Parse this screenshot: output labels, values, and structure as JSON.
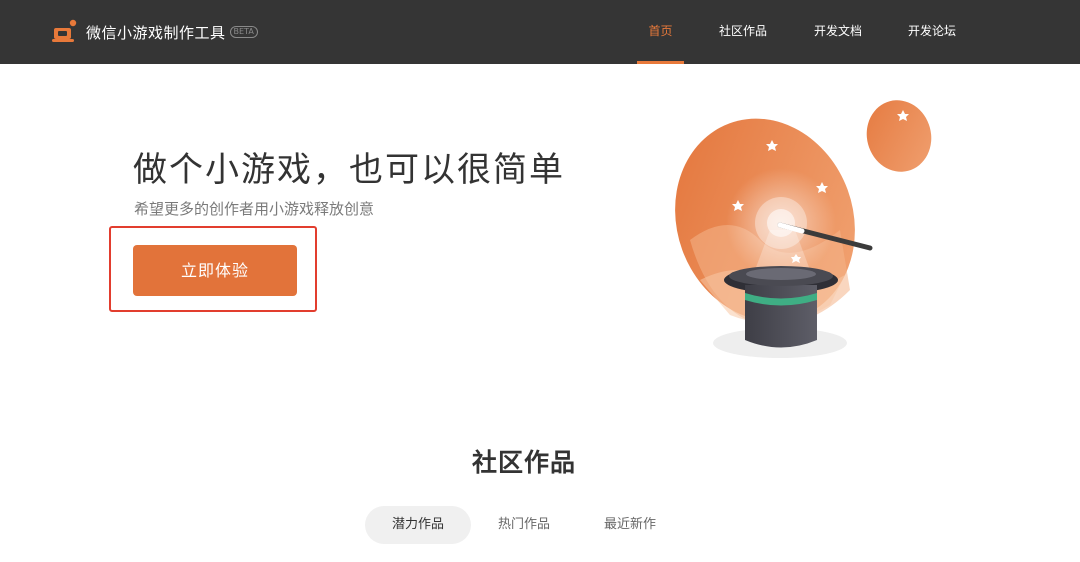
{
  "header": {
    "app_title": "微信小游戏制作工具",
    "beta_label": "BETA",
    "nav": [
      {
        "label": "首页",
        "active": true
      },
      {
        "label": "社区作品",
        "active": false
      },
      {
        "label": "开发文档",
        "active": false
      },
      {
        "label": "开发论坛",
        "active": false
      }
    ]
  },
  "hero": {
    "title": "做个小游戏，也可以很简单",
    "subtitle": "希望更多的创作者用小游戏释放创意",
    "cta_label": "立即体验"
  },
  "community": {
    "title": "社区作品",
    "tabs": [
      {
        "label": "潜力作品",
        "active": true
      },
      {
        "label": "热门作品",
        "active": false
      },
      {
        "label": "最近新作",
        "active": false
      }
    ]
  },
  "colors": {
    "header_bg": "#353535",
    "accent": "#e8793a",
    "button": "#e2733a",
    "highlight_border": "#e23d2e"
  },
  "icons": [
    "app-logo-icon",
    "magic-hat-illustration",
    "magic-wand-icon",
    "star-icon"
  ]
}
